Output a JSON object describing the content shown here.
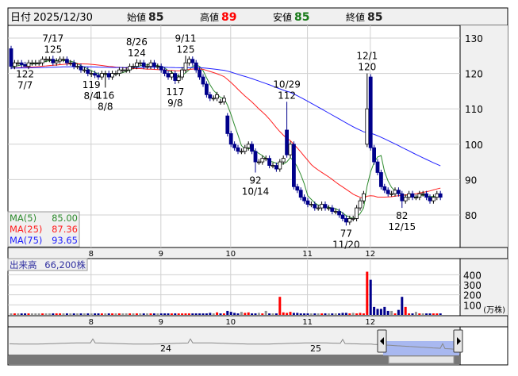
{
  "header": {
    "date_label": "日付",
    "date": "2025/12/30",
    "open_label": "始値",
    "open": "85",
    "high_label": "高値",
    "high": "89",
    "low_label": "安値",
    "low": "85",
    "close_label": "終値",
    "close": "85"
  },
  "colors": {
    "up": "#ffffff",
    "down": "#00008b",
    "ma5": "#2e8b2e",
    "ma25": "#ff2020",
    "ma75": "#2020ff",
    "vol_up": "#ff0000",
    "vol_down": "#00008b",
    "vol_flat": "#909090"
  },
  "legend": [
    {
      "label": "MA(5)",
      "value": "85.00"
    },
    {
      "label": "MA(25)",
      "value": "87.36"
    },
    {
      "label": "MA(75)",
      "value": "93.65"
    }
  ],
  "volume_legend": {
    "label": "出来高",
    "value": "66,200株"
  },
  "price_axis": {
    "ticks": [
      "130",
      "120",
      "110",
      "100",
      "90",
      "80"
    ],
    "values": [
      130,
      120,
      110,
      100,
      90,
      80
    ],
    "range": [
      130,
      80
    ]
  },
  "volume_axis": {
    "ticks": [
      "400",
      "300",
      "200",
      "100"
    ],
    "values": [
      400,
      300,
      200,
      100
    ],
    "unit": "(万株)"
  },
  "months": [
    {
      "label": "8",
      "index": 22
    },
    {
      "label": "9",
      "index": 42
    },
    {
      "label": "10",
      "index": 62
    },
    {
      "label": "11",
      "index": 84
    },
    {
      "label": "12",
      "index": 102
    }
  ],
  "navigator": {
    "labels": [
      "24",
      "25"
    ]
  },
  "chart_data": {
    "type": "candlestick",
    "closes": [
      122,
      123,
      123,
      122.5,
      122,
      123,
      123,
      123,
      123,
      124,
      124,
      124,
      123,
      123.5,
      124,
      124,
      123,
      123,
      122,
      122,
      121,
      121,
      120,
      120,
      119.5,
      119,
      120,
      120,
      119,
      120,
      120,
      121,
      121,
      121,
      122,
      122,
      123,
      123,
      122,
      122,
      123,
      122,
      122,
      121,
      120,
      119,
      120,
      118,
      119,
      121,
      123,
      124,
      123,
      121,
      119,
      117,
      114,
      113,
      113,
      114,
      112,
      113,
      103,
      100,
      99,
      98,
      98,
      99,
      100,
      98,
      95,
      95,
      96,
      96,
      94,
      94,
      93,
      95,
      96,
      97,
      100,
      88,
      87,
      85,
      84,
      83,
      83,
      82,
      82,
      83,
      82,
      82,
      81,
      81,
      80,
      79,
      78,
      79,
      79,
      82,
      84,
      86,
      110,
      99,
      95,
      92,
      88,
      87,
      86,
      86,
      87,
      86,
      84,
      85,
      86,
      85,
      85,
      86,
      86,
      85,
      84,
      85,
      86,
      85
    ],
    "open_overrides": {
      "0": 127,
      "60": 112,
      "62": 108,
      "79": 104,
      "102": 100,
      "103": 119
    },
    "annotations": [
      {
        "index": 4,
        "date": "7/7",
        "value": 122,
        "type": "low"
      },
      {
        "index": 12,
        "date": "7/17",
        "value": 125,
        "type": "high"
      },
      {
        "index": 23,
        "date": "8/4",
        "value": 119,
        "type": "low"
      },
      {
        "index": 27,
        "date": "8/8",
        "value": 116,
        "type": "low"
      },
      {
        "index": 36,
        "date": "8/26",
        "value": 124,
        "type": "high"
      },
      {
        "index": 47,
        "date": "9/8",
        "value": 117,
        "type": "low"
      },
      {
        "index": 50,
        "date": "9/11",
        "value": 125,
        "type": "high"
      },
      {
        "index": 70,
        "date": "10/14",
        "value": 92,
        "type": "low"
      },
      {
        "index": 79,
        "date": "10/29",
        "value": 112,
        "type": "high"
      },
      {
        "index": 96,
        "date": "11/20",
        "value": 77,
        "type": "low"
      },
      {
        "index": 102,
        "date": "12/1",
        "value": 120,
        "type": "high"
      },
      {
        "index": 112,
        "date": "12/15",
        "value": 82,
        "type": "low"
      }
    ],
    "volume": [
      15,
      15,
      15,
      15,
      15,
      15,
      15,
      15,
      15,
      15,
      15,
      15,
      15,
      15,
      15,
      15,
      15,
      15,
      15,
      15,
      15,
      15,
      15,
      15,
      15,
      15,
      15,
      15,
      15,
      15,
      15,
      15,
      15,
      15,
      15,
      15,
      15,
      15,
      15,
      15,
      15,
      15,
      15,
      15,
      15,
      15,
      15,
      15,
      15,
      15,
      15,
      15,
      15,
      15,
      15,
      15,
      15,
      20,
      15,
      25,
      15,
      15,
      40,
      30,
      20,
      15,
      30,
      20,
      25,
      15,
      15,
      20,
      15,
      40,
      15,
      15,
      15,
      180,
      25,
      20,
      30,
      20,
      20,
      15,
      15,
      15,
      15,
      15,
      15,
      15,
      15,
      15,
      15,
      15,
      15,
      20,
      20,
      15,
      20,
      15,
      20,
      15,
      430,
      350,
      80,
      60,
      60,
      80,
      40,
      40,
      15,
      50,
      180,
      80,
      15,
      15,
      30,
      15,
      15,
      15,
      15,
      15,
      15,
      15
    ]
  }
}
